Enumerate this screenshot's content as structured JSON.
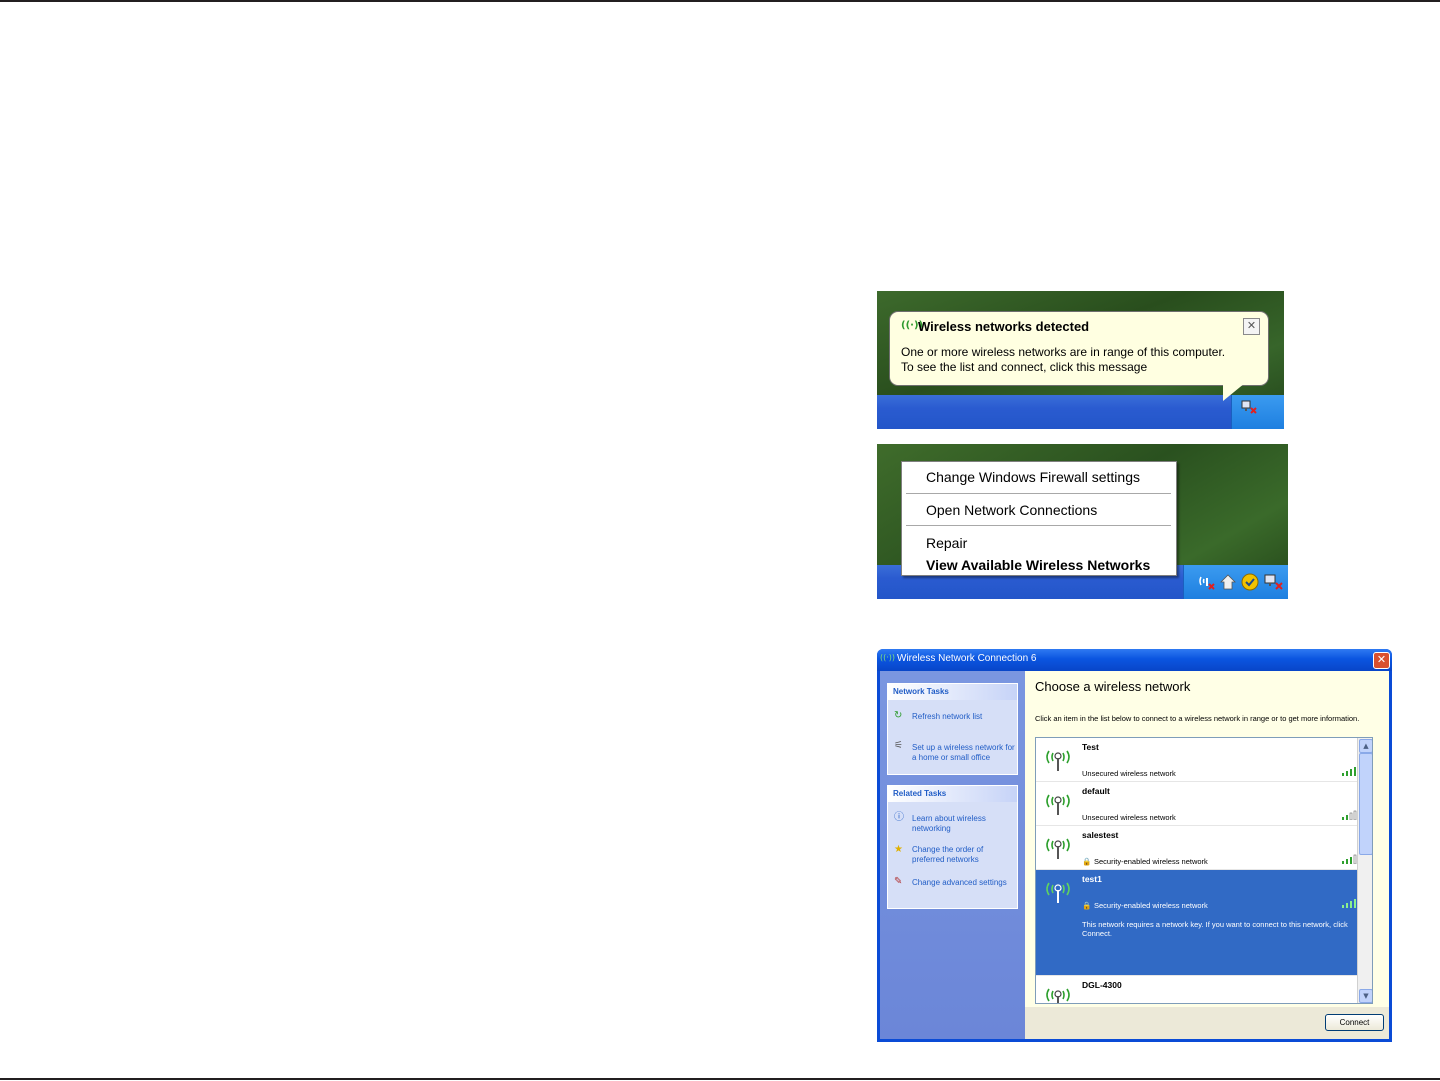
{
  "balloon": {
    "title": "Wireless networks detected",
    "line1": "One or more wireless networks are in range of this computer.",
    "line2": "To see the list and connect, click this message",
    "close_glyph": "✕",
    "icon": "wireless-icon"
  },
  "context_menu": {
    "items": [
      {
        "label": "Change Windows Firewall settings",
        "bold": false
      },
      {
        "label": "Open Network Connections",
        "bold": false
      },
      {
        "label": "Repair",
        "bold": false
      },
      {
        "label": "View Available Wireless Networks",
        "bold": true
      }
    ]
  },
  "dialog": {
    "title": "Wireless Network Connection 6",
    "close_glyph": "✕",
    "network_tasks": {
      "header": "Network Tasks",
      "items": [
        {
          "label": "Refresh network list",
          "icon": "refresh-icon"
        },
        {
          "label": "Set up a wireless network for a home or small office",
          "icon": "setup-icon"
        }
      ]
    },
    "related_tasks": {
      "header": "Related Tasks",
      "items": [
        {
          "label": "Learn about wireless networking",
          "icon": "info-icon"
        },
        {
          "label": "Change the order of preferred networks",
          "icon": "star-icon"
        },
        {
          "label": "Change advanced settings",
          "icon": "settings-icon"
        }
      ]
    },
    "heading": "Choose a wireless network",
    "instructions": "Click an item in the list below to connect to a wireless network in range or to get more information.",
    "networks": [
      {
        "name": "Test",
        "type": "Unsecured wireless network",
        "secured": false,
        "selected": false
      },
      {
        "name": "default",
        "type": "Unsecured wireless network",
        "secured": false,
        "selected": false
      },
      {
        "name": "salestest",
        "type": "Security-enabled wireless network",
        "secured": true,
        "selected": false
      },
      {
        "name": "test1",
        "type": "Security-enabled wireless network",
        "secured": true,
        "selected": true,
        "description": "This network requires a network key. If you want to connect to this network, click Connect."
      },
      {
        "name": "DGL-4300",
        "type": "",
        "secured": false,
        "selected": false
      }
    ],
    "connect_label": "Connect",
    "colors": {
      "titlebar": "#0b55e0",
      "selection": "#316ac5",
      "task_pane": "#7a96e0"
    }
  }
}
